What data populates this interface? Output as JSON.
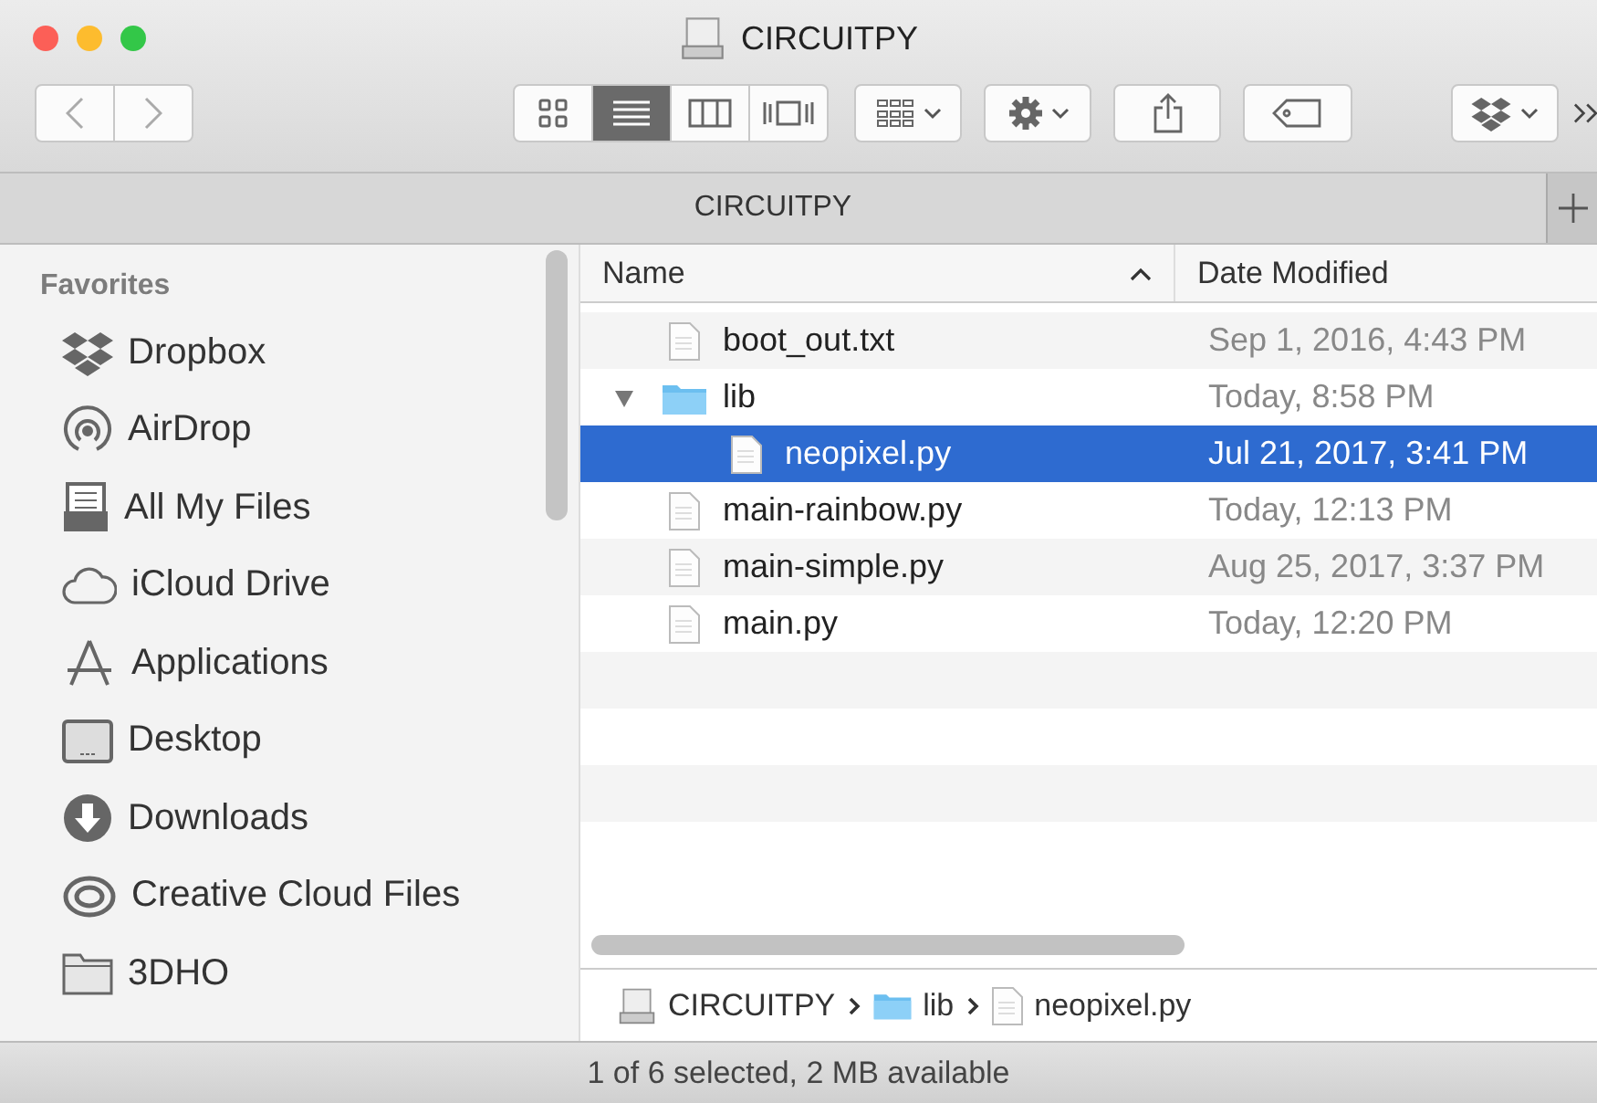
{
  "window": {
    "title": "CIRCUITPY"
  },
  "toolbar": {
    "views": [
      {
        "kind": "icons",
        "selected": false
      },
      {
        "kind": "list",
        "selected": true
      },
      {
        "kind": "columns",
        "selected": false
      },
      {
        "kind": "coverflow",
        "selected": false
      }
    ]
  },
  "tabs": [
    {
      "label": "CIRCUITPY",
      "selected": true
    }
  ],
  "sidebar": {
    "heading": "Favorites",
    "items": [
      {
        "label": "Dropbox",
        "kind": "dropbox"
      },
      {
        "label": "AirDrop",
        "kind": "airdrop"
      },
      {
        "label": "All My Files",
        "kind": "allfiles"
      },
      {
        "label": "iCloud Drive",
        "kind": "cloud"
      },
      {
        "label": "Applications",
        "kind": "apps"
      },
      {
        "label": "Desktop",
        "kind": "desktop"
      },
      {
        "label": "Downloads",
        "kind": "downloads"
      },
      {
        "label": "Creative Cloud Files",
        "kind": "creative"
      },
      {
        "label": "3DHO",
        "kind": "folder"
      }
    ]
  },
  "table": {
    "columns": [
      {
        "label": "Name",
        "sorted": true
      },
      {
        "label": "Date Modified",
        "sorted": false
      }
    ],
    "rows": [
      {
        "name": "boot_out.txt",
        "date": "Sep 1, 2016, 4:43 PM",
        "kind": "file",
        "selected": false
      },
      {
        "name": "lib",
        "date": "Today, 8:58 PM",
        "kind": "folder",
        "expanded": true,
        "selected": false,
        "children": [
          {
            "name": "neopixel.py",
            "date": "Jul 21, 2017, 3:41 PM",
            "kind": "file",
            "selected": true
          }
        ]
      },
      {
        "name": "main-rainbow.py",
        "date": "Today, 12:13 PM",
        "kind": "file",
        "selected": false
      },
      {
        "name": "main-simple.py",
        "date": "Aug 25, 2017, 3:37 PM",
        "kind": "file",
        "selected": false
      },
      {
        "name": "main.py",
        "date": "Today, 12:20 PM",
        "kind": "file",
        "selected": false
      }
    ]
  },
  "path_bar": [
    {
      "label": "CIRCUITPY",
      "kind": "drive"
    },
    {
      "label": "lib",
      "kind": "folder"
    },
    {
      "label": "neopixel.py",
      "kind": "file"
    }
  ],
  "status_bar": "1 of 6 selected, 2 MB available"
}
